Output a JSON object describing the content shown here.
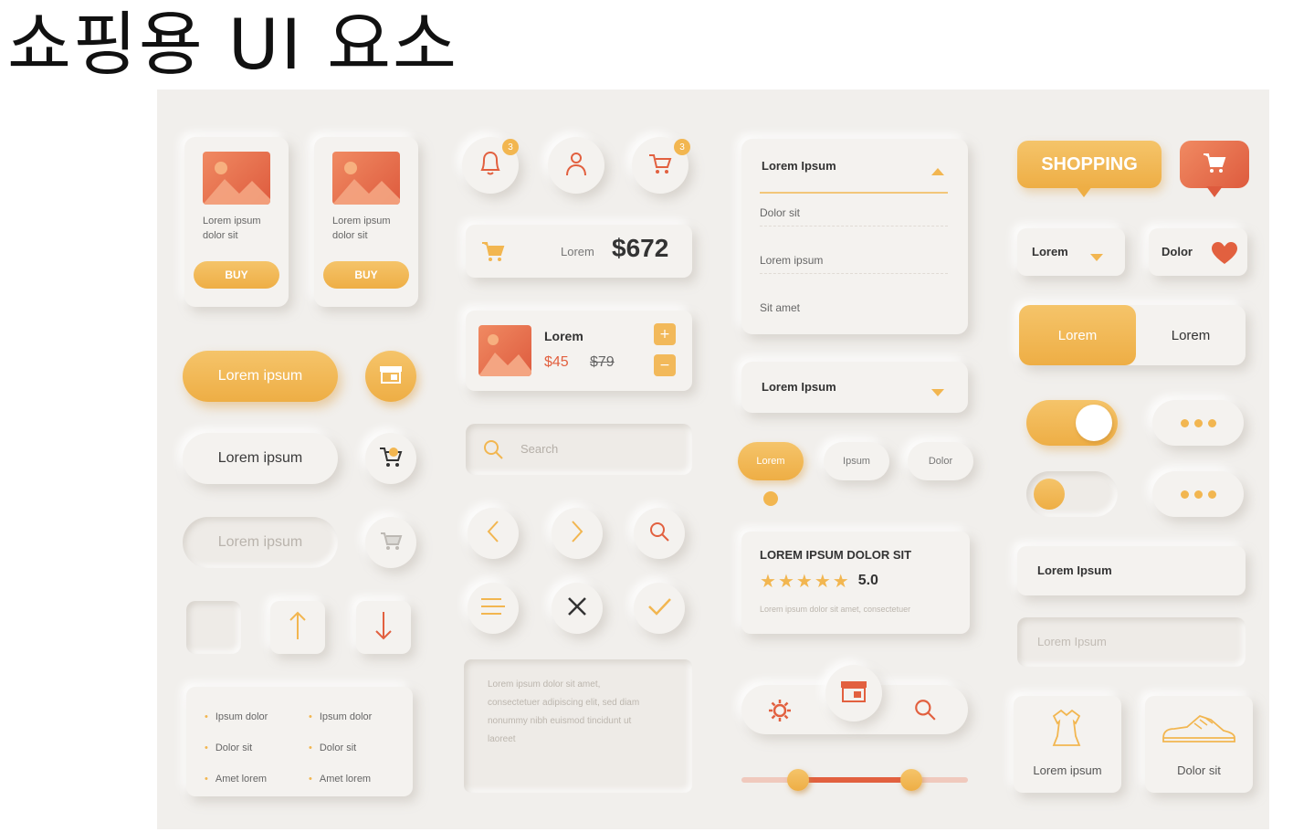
{
  "page_title": "쇼핑용 UI 요소",
  "colors": {
    "accent": "#f2b650",
    "accent_dark": "#eeae45",
    "red": "#e2603f",
    "background": "#f1efec"
  },
  "product_cards": [
    {
      "name": "Lorem ipsum dolor sit",
      "line1": "Lorem ipsum",
      "line2": "dolor sit",
      "button": "BUY"
    },
    {
      "name": "Lorem ipsum dolor sit",
      "line1": "Lorem ipsum",
      "line2": "dolor sit",
      "button": "BUY"
    }
  ],
  "buttons": {
    "primary": "Lorem ipsum",
    "secondary": "Lorem ipsum",
    "disabled": "Lorem ipsum"
  },
  "icons_top": {
    "bell_badge": "3",
    "cart_badge": "3"
  },
  "cart_total": {
    "label": "Lorem",
    "amount": "$672"
  },
  "cart_item": {
    "name": "Lorem",
    "price": "$45",
    "old_price": "$79",
    "plus": "+",
    "minus": "−"
  },
  "search": {
    "placeholder": "Search"
  },
  "textarea": {
    "text": "Lorem ipsum dolor sit amet, consectetuer adipiscing elit, sed diam nonummy nibh euismod tincidunt ut laoreet"
  },
  "bullet_lists": {
    "left": [
      "Ipsum dolor",
      "Dolor sit",
      "Amet lorem"
    ],
    "right": [
      "Ipsum dolor",
      "Dolor sit",
      "Amet lorem"
    ]
  },
  "dropdown_open": {
    "header": "Lorem Ipsum",
    "options": [
      "Dolor sit",
      "Lorem ipsum",
      "Sit amet"
    ]
  },
  "dropdown_closed": {
    "value": "Lorem Ipsum"
  },
  "tags": {
    "items": [
      "Lorem",
      "Ipsum",
      "Dolor"
    ],
    "active_index": 0
  },
  "rating_card": {
    "title": "LOREM IPSUM DOLOR SIT",
    "stars": 5,
    "score": "5.0",
    "text": "Lorem ipsum dolor sit amet, consectetuer"
  },
  "range_slider": {
    "low": 0.25,
    "high": 0.75
  },
  "speech_bubble": {
    "label": "SHOPPING"
  },
  "small_dropdowns": {
    "left": "Lorem",
    "right": "Dolor"
  },
  "segmented": {
    "options": [
      "Lorem",
      "Lorem"
    ],
    "active_index": 0
  },
  "toggles": {
    "first_on": true,
    "second_on": false
  },
  "inputs": {
    "filled": "Lorem Ipsum",
    "placeholder": "Lorem Ipsum"
  },
  "category_cards": [
    {
      "label": "Lorem ipsum",
      "icon": "dress-icon"
    },
    {
      "label": "Dolor sit",
      "icon": "sneaker-icon"
    }
  ]
}
